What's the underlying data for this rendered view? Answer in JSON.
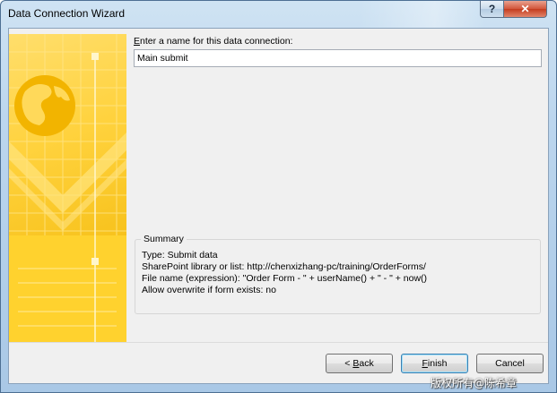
{
  "window": {
    "title": "Data Connection Wizard",
    "help_label": "?",
    "close_label": "✕"
  },
  "form": {
    "name_label_prefix": "E",
    "name_label_rest": "nter a name for this data connection:",
    "name_value": "Main submit"
  },
  "summary": {
    "legend": "Summary",
    "lines": [
      "Type: Submit data",
      "SharePoint library or list: http://chenxizhang-pc/training/OrderForms/",
      "File name (expression): \"Order Form - \" + userName() + \" - \" + now()",
      "Allow overwrite if form exists: no"
    ]
  },
  "buttons": {
    "back_prefix": "< ",
    "back_accel": "B",
    "back_rest": "ack",
    "finish_accel": "F",
    "finish_rest": "inish",
    "cancel": "Cancel"
  },
  "watermark": "版权所有@陈希章",
  "colors": {
    "banner": "#f7c21c",
    "default_button_border": "#3c7fb1"
  }
}
